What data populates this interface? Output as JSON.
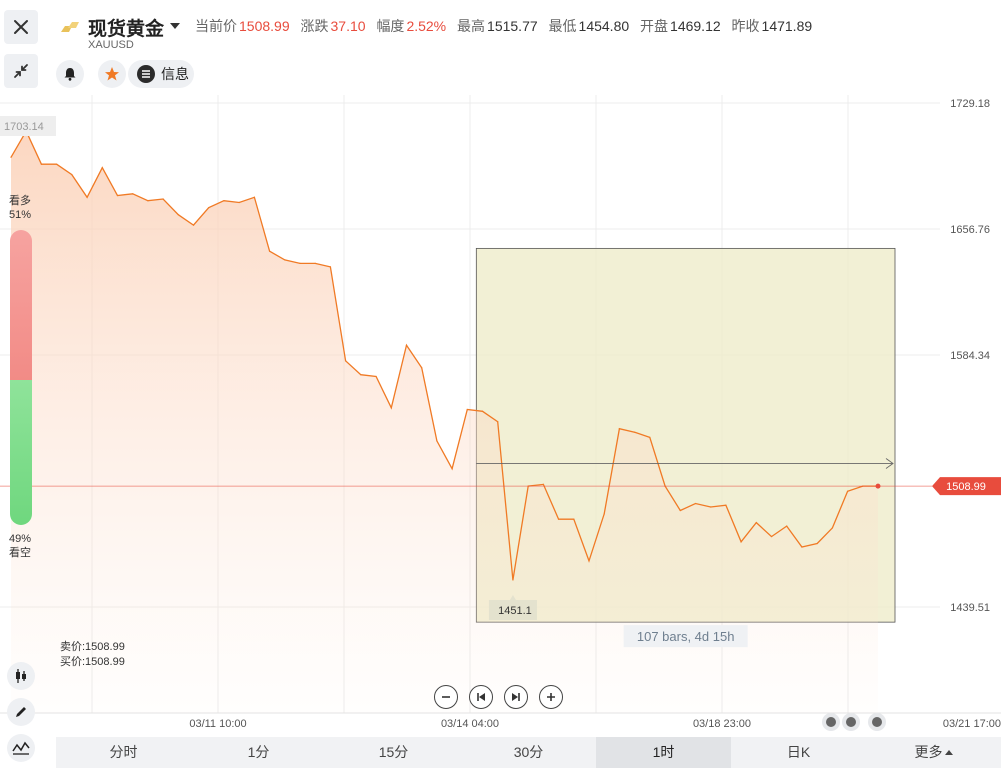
{
  "symbol": {
    "name": "现货黄金",
    "code": "XAUUSD"
  },
  "quote": {
    "current_label": "当前价",
    "current": "1508.99",
    "change_label": "涨跌",
    "change": "37.10",
    "pct_label": "幅度",
    "pct": "2.52%",
    "high_label": "最高",
    "high": "1515.77",
    "low_label": "最低",
    "low": "1454.80",
    "open_label": "开盘",
    "open": "1469.12",
    "prev_label": "昨收",
    "prev": "1471.89"
  },
  "actions": {
    "info_label": "信息"
  },
  "sentiment": {
    "bull_label": "看多",
    "bull_pct": "51%",
    "bull_value": 0.51,
    "bear_label": "看空",
    "bear_pct": "49%"
  },
  "bid_ask": {
    "sell": "卖价:1508.99",
    "buy": "买价:1508.99"
  },
  "periods": {
    "tabs": [
      "分时",
      "1分",
      "15分",
      "30分",
      "1时",
      "日K",
      "更多"
    ],
    "active": "1时"
  },
  "colors": {
    "line": "#f07a25",
    "up": "#e84c3d",
    "range_box": "#efeccb",
    "bull": "#f28b86",
    "bear": "#6fd77e"
  },
  "chart_data": {
    "type": "area",
    "y_ticks": [
      "1729.18",
      "1656.76",
      "1584.34",
      "1508.99",
      "1439.51"
    ],
    "y_tick_values": [
      1729.18,
      1656.76,
      1584.34,
      1511.92,
      1439.51
    ],
    "ylim": [
      1382.4,
      1799.4
    ],
    "x_ticks": [
      "03/11 10:00",
      "03/14 04:00",
      "03/18 23:00",
      "03/21 17:00"
    ],
    "x": [
      1,
      2,
      3,
      4,
      5,
      6,
      7,
      8,
      9,
      10,
      11,
      12,
      13,
      14,
      15,
      16,
      17,
      18,
      19,
      20,
      21,
      22,
      23,
      24,
      25,
      26,
      27,
      28,
      29,
      30,
      31,
      32,
      33,
      34,
      35,
      36,
      37,
      38,
      39,
      40,
      41,
      42,
      43,
      44,
      45,
      46,
      47,
      48,
      49,
      50,
      51,
      52,
      53,
      54,
      55,
      56,
      57,
      58
    ],
    "series": [
      {
        "values": [
          1698,
          1713,
          1694,
          1694,
          1688,
          1675,
          1692,
          1676,
          1677,
          1673,
          1674,
          1665,
          1659,
          1669,
          1673,
          1672,
          1675,
          1644,
          1639,
          1637,
          1637,
          1635,
          1581,
          1573,
          1572,
          1554,
          1590,
          1577,
          1535,
          1519,
          1553,
          1552,
          1546,
          1455,
          1509,
          1510,
          1490,
          1490,
          1466,
          1493,
          1542,
          1540,
          1537,
          1509,
          1495,
          1499,
          1497,
          1498,
          1477,
          1488,
          1480,
          1486,
          1474,
          1476,
          1485,
          1506,
          1509,
          1509
        ]
      }
    ],
    "current_price": "1508.99",
    "current_value": 1508.99,
    "low_marker": "1451.1",
    "low_marker_value": 1451.1,
    "range_measure": {
      "label": "107 bars, 4d 15h",
      "from_x": 31,
      "to_x": 58,
      "low": 1440,
      "high": 1637
    }
  }
}
